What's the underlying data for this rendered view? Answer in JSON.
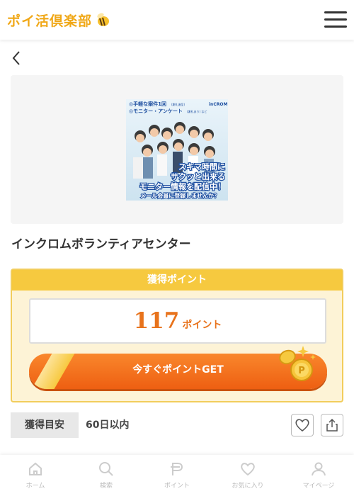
{
  "header": {
    "logo_text": "ポイ活倶楽部",
    "menu_icon": "hamburger-icon"
  },
  "navigation": {
    "back_icon": "chevron-left-icon"
  },
  "offer": {
    "title": "インクロムボランティアセンター",
    "banner": {
      "line1": "◎手軽な案件1回",
      "line1_note": "(謝礼進呈)",
      "line2": "◎モニター・アンケート",
      "line2_note": "(謝礼あり) など",
      "brand": "inCROM",
      "catch1": "スキマ時間に",
      "catch2": "サクッと出来る",
      "catch3": "モニター情報を配信中！",
      "catch4": "メール会員に登録しませんか？"
    }
  },
  "points": {
    "header": "獲得ポイント",
    "value": "117",
    "unit": "ポイント",
    "button_label": "今すぐポイントGET"
  },
  "estimate": {
    "label": "獲得目安",
    "value": "60日以内"
  },
  "actions": {
    "favorite_icon": "heart-icon",
    "share_icon": "share-icon"
  },
  "bottom_nav": {
    "items": [
      {
        "label": "ホーム",
        "icon": "home-icon"
      },
      {
        "label": "検索",
        "icon": "search-icon"
      },
      {
        "label": "ポイント",
        "icon": "point-icon"
      },
      {
        "label": "お気に入り",
        "icon": "heart-icon"
      },
      {
        "label": "マイページ",
        "icon": "user-icon"
      }
    ]
  },
  "colors": {
    "brand": "#f0a818",
    "accent": "#ee5f12",
    "point_header": "#f6c93f",
    "point_bg": "#fdf3d6"
  }
}
